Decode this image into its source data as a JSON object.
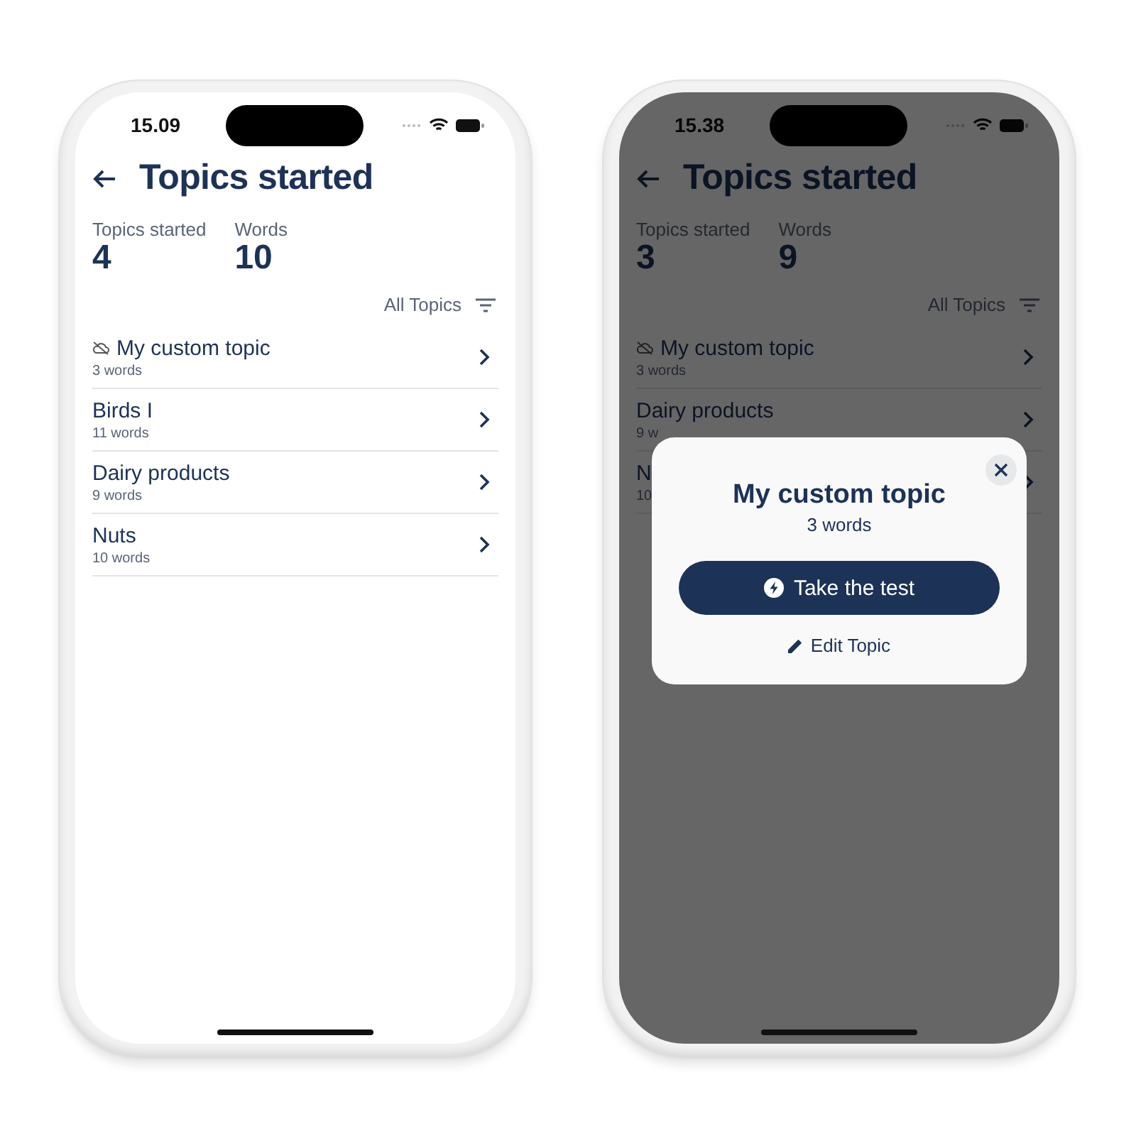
{
  "phones": [
    {
      "status_time": "15.09",
      "title": "Topics started",
      "stats": [
        {
          "label": "Topics started",
          "value": "4"
        },
        {
          "label": "Words",
          "value": "10"
        }
      ],
      "filter": "All Topics",
      "dimmed": false,
      "topics": [
        {
          "kind": "custom",
          "name": "My custom topic",
          "count": "3 words"
        },
        {
          "kind": "standard",
          "name": "Birds I",
          "count": "11 words"
        },
        {
          "kind": "standard",
          "name": "Dairy products",
          "count": "9 words"
        },
        {
          "kind": "standard",
          "name": "Nuts",
          "count": "10 words"
        }
      ]
    },
    {
      "status_time": "15.38",
      "title": "Topics started",
      "stats": [
        {
          "label": "Topics started",
          "value": "3"
        },
        {
          "label": "Words",
          "value": "9"
        }
      ],
      "filter": "All Topics",
      "dimmed": true,
      "topics": [
        {
          "kind": "custom",
          "name": "My custom topic",
          "count": "3 words"
        },
        {
          "kind": "standard",
          "name": "Dairy products",
          "count": "9 w"
        },
        {
          "kind": "standard",
          "name": "N",
          "count": "10"
        }
      ],
      "dialog": {
        "title": "My custom topic",
        "subtitle": "3 words",
        "primary_button": "Take the test",
        "secondary_button": "Edit Topic"
      }
    }
  ]
}
